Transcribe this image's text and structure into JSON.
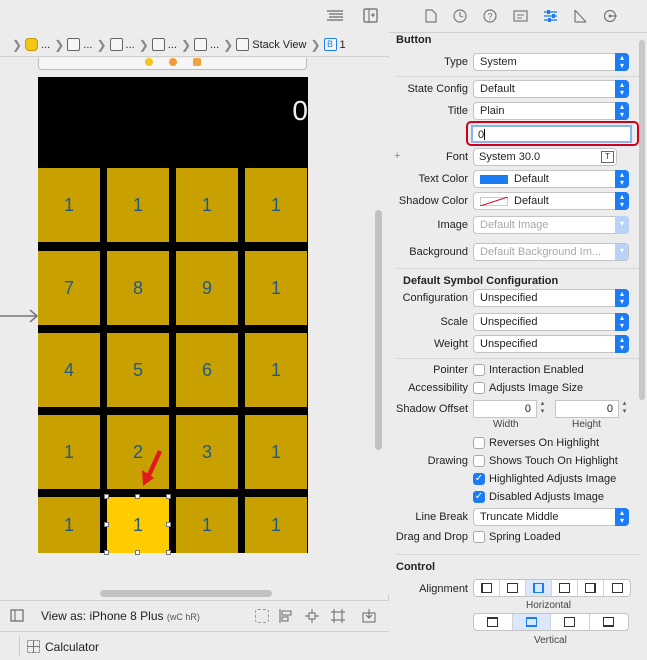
{
  "jumpbar": {
    "items": [
      {
        "label": "..."
      },
      {
        "label": "..."
      },
      {
        "label": "..."
      },
      {
        "label": "..."
      },
      {
        "label": "..."
      },
      {
        "label": "Stack View"
      },
      {
        "label": "B"
      },
      {
        "label": "1"
      }
    ]
  },
  "calculator": {
    "display": "0",
    "rows": [
      [
        "1",
        "1",
        "1",
        "1"
      ],
      [
        "7",
        "8",
        "9",
        "1"
      ],
      [
        "4",
        "5",
        "6",
        "1"
      ],
      [
        "1",
        "2",
        "3",
        "1"
      ],
      [
        "1",
        "1",
        "1",
        "1"
      ]
    ],
    "selected_row": 4,
    "selected_col": 1,
    "key_color": "#c8a000",
    "selected_key_color": "#ffcc00",
    "key_text_color": "#1f5b86"
  },
  "bottom_bar": {
    "view_as": "View as: iPhone 8 Plus",
    "size_class": "(wC hR)"
  },
  "status_bar": {
    "label": "Calculator"
  },
  "inspector": {
    "section_button": "Button",
    "type_label": "Type",
    "type_value": "System",
    "state_label": "State Config",
    "state_value": "Default",
    "title_label": "Title",
    "title_value": "Plain",
    "title_text": "0",
    "font_label": "Font",
    "font_value": "System 30.0",
    "text_color_label": "Text Color",
    "text_color_value": "Default",
    "shadow_color_label": "Shadow Color",
    "shadow_color_value": "Default",
    "image_label": "Image",
    "image_placeholder": "Default Image",
    "background_label": "Background",
    "background_placeholder": "Default Background Im...",
    "section_symbol": "Default Symbol Configuration",
    "configuration_label": "Configuration",
    "configuration_value": "Unspecified",
    "scale_label": "Scale",
    "scale_value": "Unspecified",
    "weight_label": "Weight",
    "weight_value": "Unspecified",
    "pointer_label": "Pointer",
    "pointer_option": "Interaction Enabled",
    "accessibility_label": "Accessibility",
    "accessibility_option": "Adjusts Image Size",
    "shadow_offset_label": "Shadow Offset",
    "shadow_width_value": "0",
    "shadow_height_value": "0",
    "width_caption": "Width",
    "height_caption": "Height",
    "reverses_option": "Reverses On Highlight",
    "drawing_label": "Drawing",
    "shows_touch_option": "Shows Touch On Highlight",
    "highlighted_option": "Highlighted Adjusts Image",
    "disabled_option": "Disabled Adjusts Image",
    "line_break_label": "Line Break",
    "line_break_value": "Truncate Middle",
    "drag_drop_label": "Drag and Drop",
    "spring_loaded_option": "Spring Loaded",
    "section_control": "Control",
    "alignment_label": "Alignment",
    "horizontal_caption": "Horizontal",
    "vertical_caption": "Vertical",
    "accent_color": "#1c7cf4",
    "highlight_border_color": "#d0021b"
  }
}
